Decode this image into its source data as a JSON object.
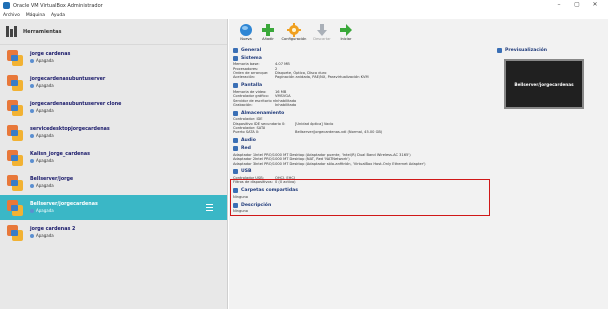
{
  "window": {
    "title": "Oracle VM VirtualBox Administrador",
    "min": "–",
    "max": "▢",
    "close": "✕"
  },
  "menu": [
    "Archivo",
    "Máquina",
    "Ayuda"
  ],
  "tools_label": "Herramientas",
  "vms": [
    {
      "name": "jorge cardenas",
      "state": "Apagada",
      "selected": false
    },
    {
      "name": "jorgecardenasubuntuserver",
      "state": "Apagada",
      "selected": false
    },
    {
      "name": "jorgecardenasubuntuserver clone",
      "state": "Apagada",
      "selected": false
    },
    {
      "name": "servicedesktopjorgecardenas",
      "state": "Apagada",
      "selected": false
    },
    {
      "name": "Kalisn_jorge_cardenas",
      "state": "Apagada",
      "selected": false
    },
    {
      "name": "Bellserver/jorge",
      "state": "Apagada",
      "selected": false
    },
    {
      "name": "Bellserver/jorgecardenas",
      "state": "Apagada",
      "selected": true
    },
    {
      "name": "jorge cardenas 2",
      "state": "Apagada",
      "selected": false
    }
  ],
  "toolbar": [
    {
      "label": "Nueva",
      "icon": "new-icon",
      "disabled": false
    },
    {
      "label": "Añadir",
      "icon": "add-icon",
      "disabled": false
    },
    {
      "label": "Configuración",
      "icon": "settings-icon",
      "disabled": false
    },
    {
      "label": "Descartar",
      "icon": "discard-icon",
      "disabled": true
    },
    {
      "label": "Iniciar",
      "icon": "start-icon",
      "disabled": false
    }
  ],
  "sections": {
    "general": {
      "title": "General"
    },
    "system": {
      "title": "Sistema",
      "rows": [
        {
          "k": "Memoria base:",
          "v": "4.07 MB"
        },
        {
          "k": "Procesadores:",
          "v": "2"
        },
        {
          "k": "Orden de arranque:",
          "v": "Disquete, Óptico, Disco duro"
        },
        {
          "k": "Aceleración:",
          "v": "Paginación anidada, PAE/NX, Paravirtualización KVM"
        }
      ]
    },
    "display": {
      "title": "Pantalla",
      "rows": [
        {
          "k": "Memoria de video:",
          "v": "16 MB"
        },
        {
          "k": "Controlador gráfico:",
          "v": "VMSVGA"
        },
        {
          "k": "Servidor de escritorio remoto:",
          "v": "Inhabilitado"
        },
        {
          "k": "Grabación:",
          "v": "Inhabilitado"
        }
      ]
    },
    "storage": {
      "title": "Almacenamiento",
      "rows": [
        {
          "k": "Controlador: IDE",
          "v": ""
        },
        {
          "k": "Dispositivo IDE secundario 0:",
          "v": "[Unidad óptica] Vacío"
        },
        {
          "k": "Controlador: SATA",
          "v": ""
        },
        {
          "k": "Puerto SATA 0:",
          "v": "Bellserver/jorgecardenas.vdi (Normal, 45.00 GB)"
        }
      ]
    },
    "audio": {
      "title": "Audio"
    },
    "network": {
      "title": "Red",
      "rows": [
        {
          "k": "Adaptador 1:",
          "v": "Intel PRO/1000 MT Desktop (Adaptador puente, 'Intel(R) Dual Band Wireless-AC 3165')"
        },
        {
          "k": "Adaptador 2:",
          "v": "Intel PRO/1000 MT Desktop (NAT, Red 'NATNetwork')"
        },
        {
          "k": "Adaptador 3:",
          "v": "Intel PRO/1000 MT Desktop (Adaptador sólo-anfitrión, 'VirtualBox Host-Only Ethernet Adapter')"
        }
      ]
    },
    "usb": {
      "title": "USB",
      "rows": [
        {
          "k": "Controlador USB:",
          "v": "OHCI, EHCI"
        },
        {
          "k": "Filtros de dispositivos:",
          "v": "0 (0 activo)"
        }
      ]
    },
    "shared": {
      "title": "Carpetas compartidas",
      "value": "Ninguno"
    },
    "description": {
      "title": "Descripción",
      "value": "Ninguno"
    }
  },
  "preview": {
    "title": "Previsualización",
    "screen_text": "Bellserver/jorgecardenas"
  },
  "colors": {
    "selected": "#3ab7c6",
    "highlight_box": "#d01818",
    "accent": "#3a6fb5"
  }
}
